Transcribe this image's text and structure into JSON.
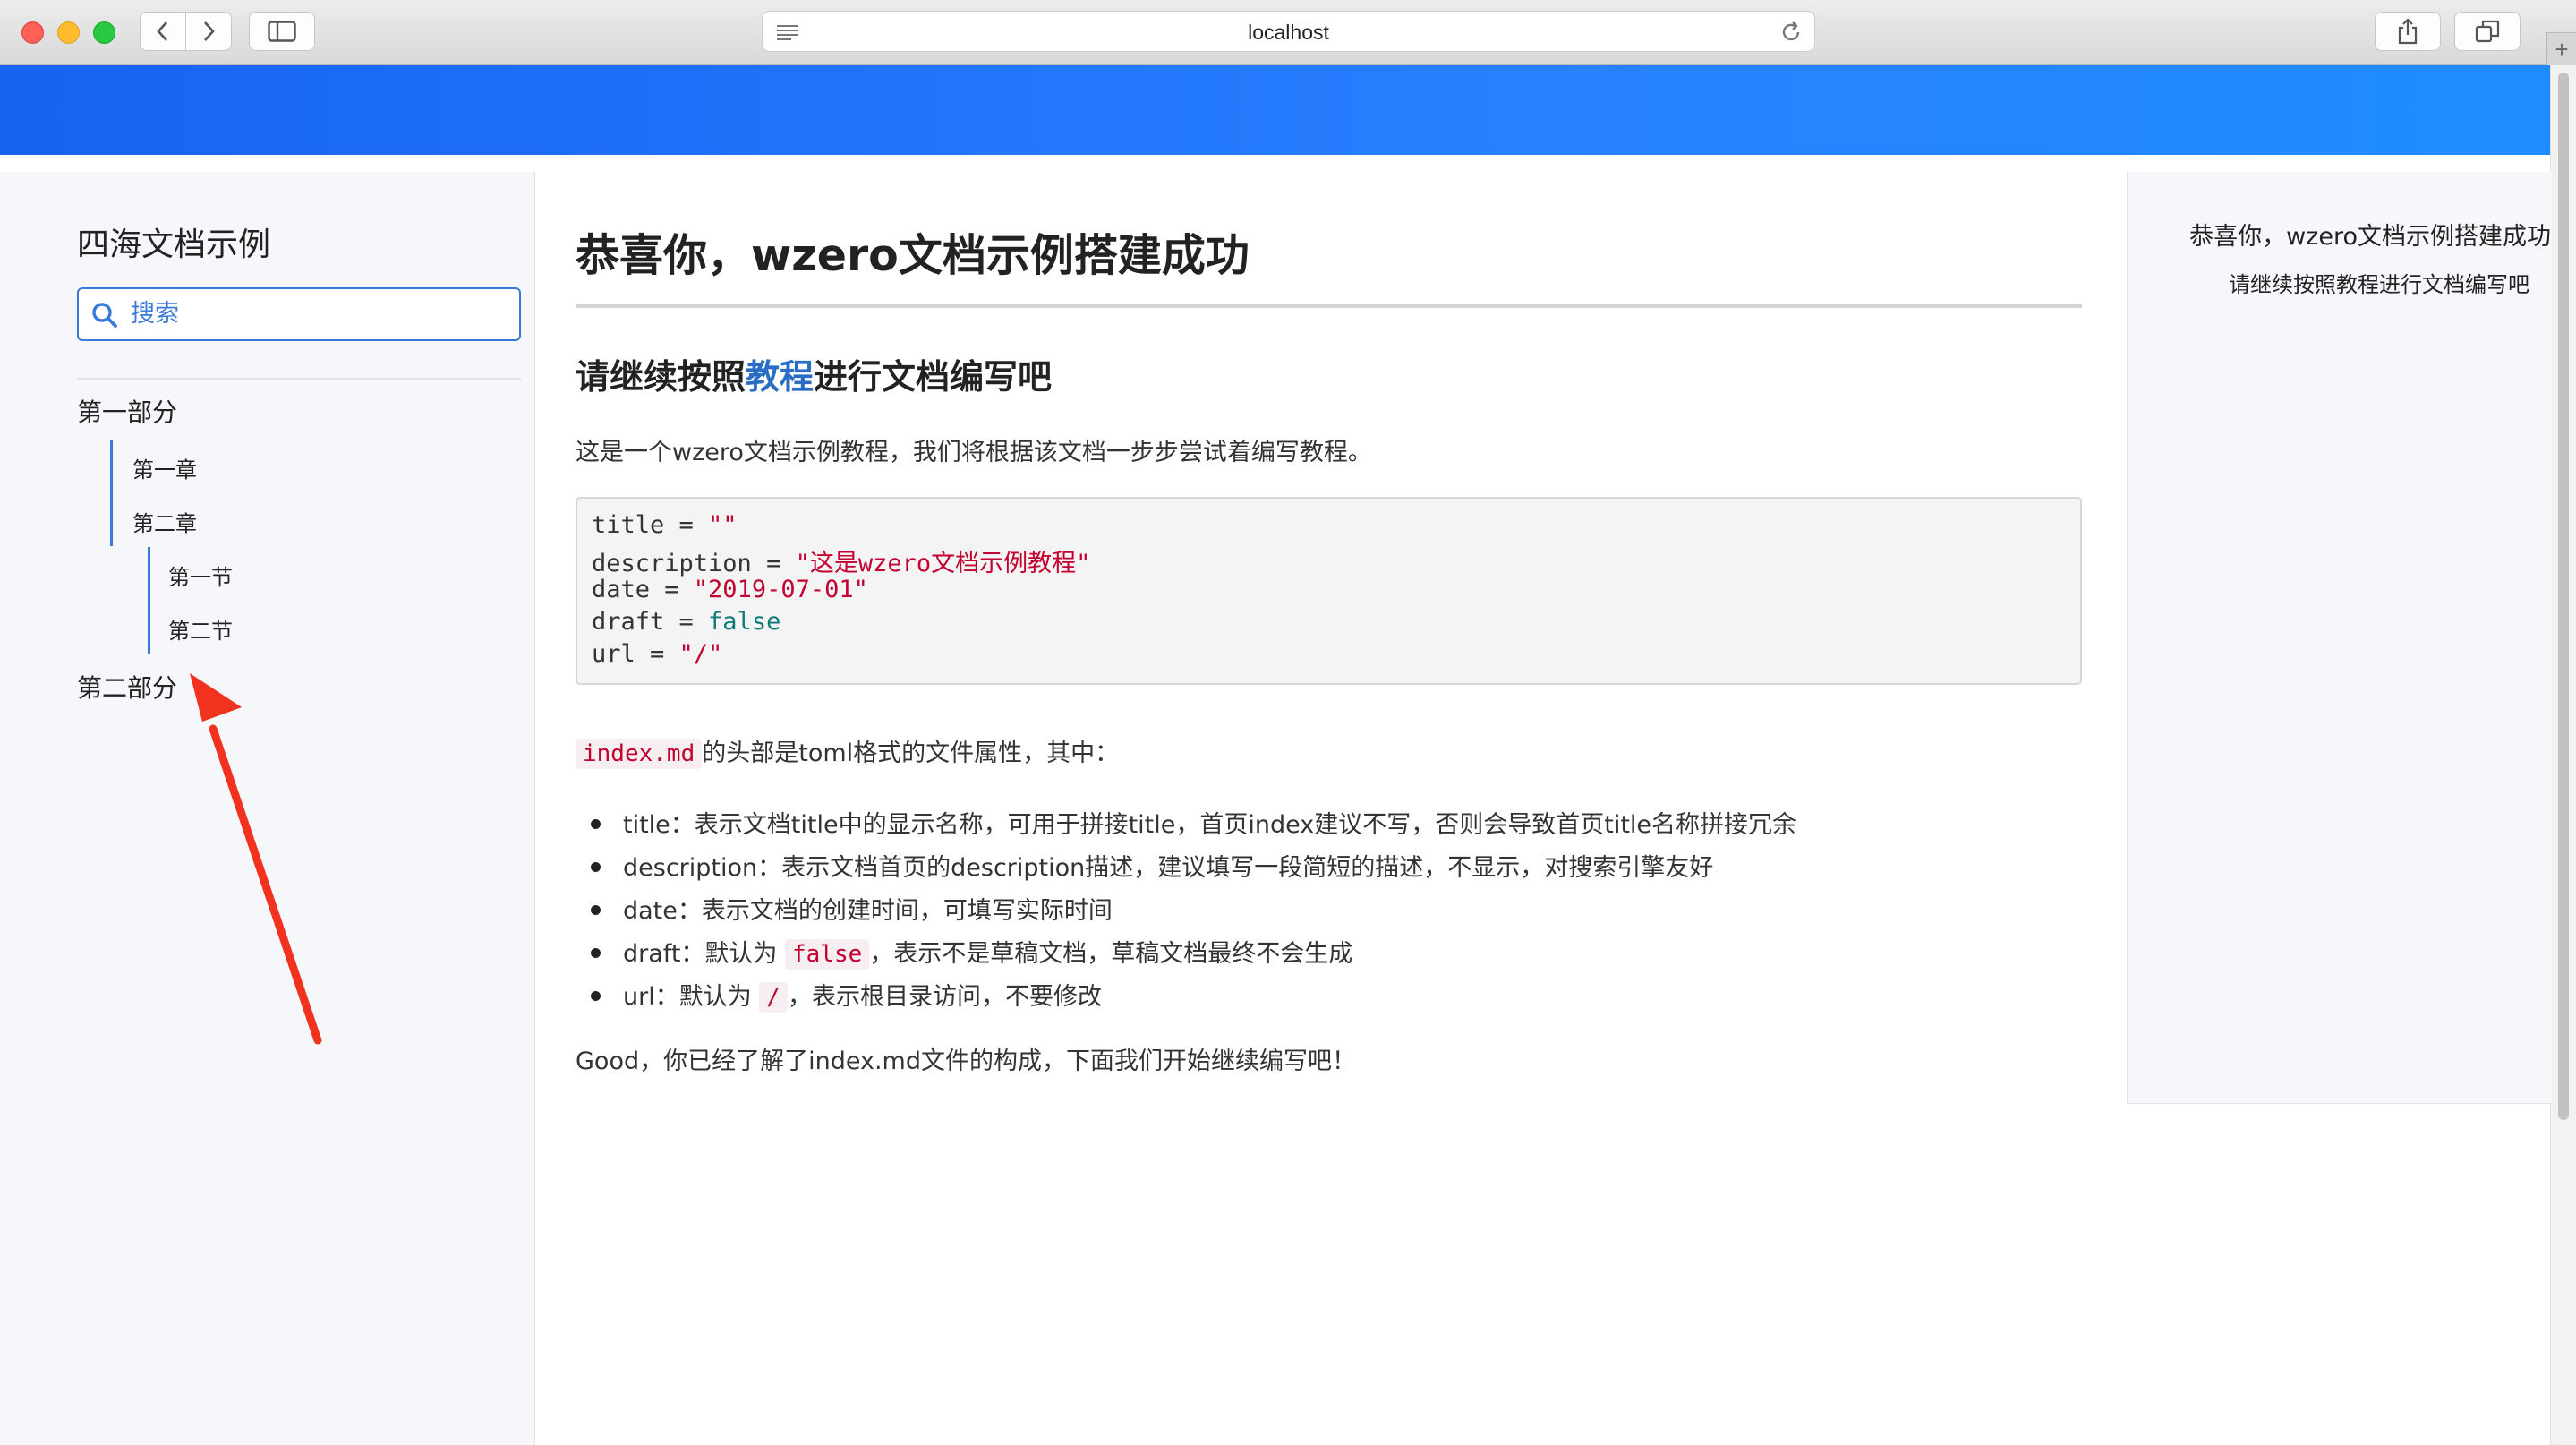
{
  "browser": {
    "url": "localhost",
    "plus_label": "+"
  },
  "sidebar": {
    "brand": "四海文档示例",
    "search_placeholder": "搜索",
    "items": [
      {
        "label": "第一部分"
      },
      {
        "label": "第一章"
      },
      {
        "label": "第二章"
      },
      {
        "label": "第一节"
      },
      {
        "label": "第二节"
      },
      {
        "label": "第二部分"
      }
    ]
  },
  "content": {
    "title": "恭喜你，wzero文档示例搭建成功",
    "subtitle_before": "请继续按照",
    "subtitle_link": "教程",
    "subtitle_after": "进行文档编写吧",
    "intro": "这是一个wzero文档示例教程，我们将根据该文档一步步尝试着编写教程。",
    "code": {
      "l1_key": "title = ",
      "l1_val": "\"\"",
      "l2_key": "description = ",
      "l2_val": "\"这是wzero文档示例教程\"",
      "l3_key": "date = ",
      "l3_val": "\"2019-07-01\"",
      "l4_key": "draft = ",
      "l4_val": "false",
      "l5_key": "url = ",
      "l5_val": "\"/\""
    },
    "attr_code": "index.md",
    "attr_text": "的头部是toml格式的文件属性，其中：",
    "bullets": {
      "b1": "title：表示文档title中的显示名称，可用于拼接title，首页index建议不写，否则会导致首页title名称拼接冗余",
      "b2": "description：表示文档首页的description描述，建议填写一段简短的描述，不显示，对搜索引擎友好",
      "b3": "date：表示文档的创建时间，可填写实际时间",
      "b4_before": "draft：默认为 ",
      "b4_code": "false",
      "b4_after": "，表示不是草稿文档，草稿文档最终不会生成",
      "b5_before": "url：默认为 ",
      "b5_code": "/",
      "b5_after": "，表示根目录访问，不要修改"
    },
    "closing": "Good，你已经了解了index.md文件的构成，下面我们开始继续编写吧！"
  },
  "toc": {
    "item1": "恭喜你，wzero文档示例搭建成功",
    "item2": "请继续按照教程进行文档编写吧"
  },
  "colors": {
    "banner_start": "#1763f2",
    "banner_end": "#1f8dff",
    "accent": "#3c78d8",
    "annotation_arrow": "#f0321e",
    "code_string": "#c3002f",
    "code_keyword": "#0e7a76"
  },
  "icons": [
    "close-light",
    "minimize-light",
    "zoom-light",
    "back-icon",
    "forward-icon",
    "sidebar-toggle-icon",
    "reader-icon",
    "reload-icon",
    "share-icon",
    "tabs-icon",
    "search-icon",
    "annotation-arrow"
  ]
}
